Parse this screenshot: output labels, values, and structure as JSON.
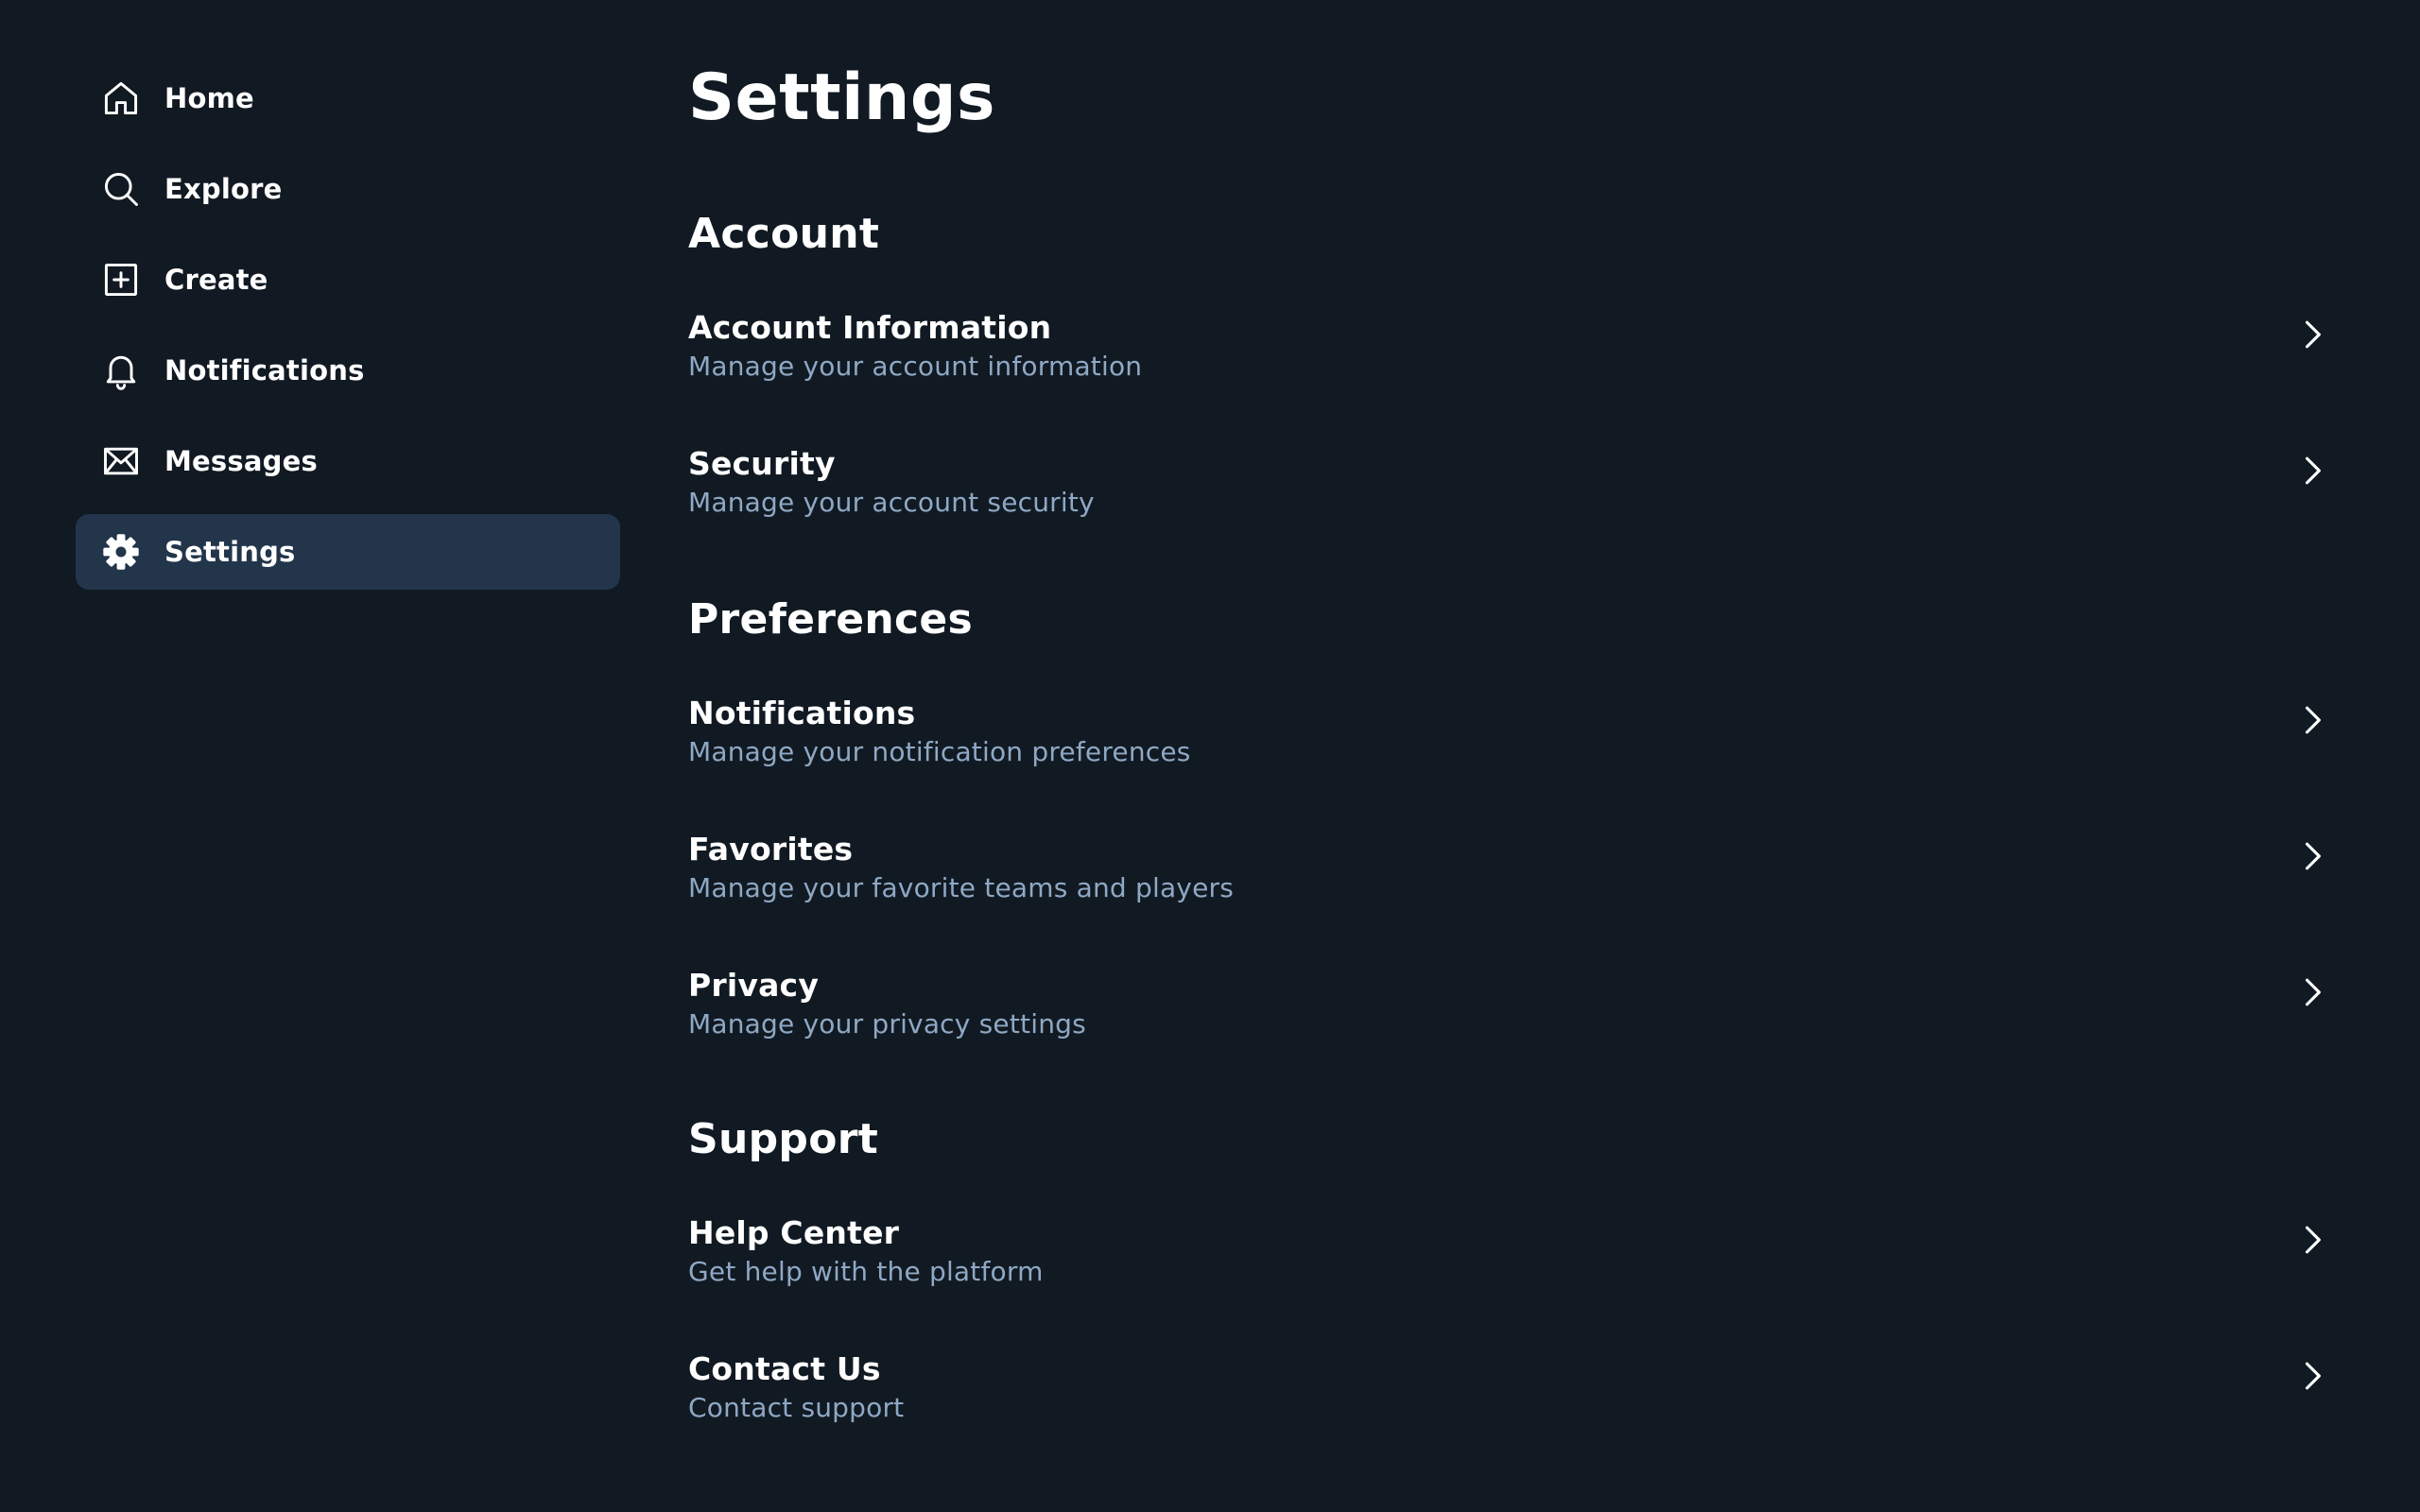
{
  "sidebar": {
    "items": [
      {
        "label": "Home",
        "icon": "home-icon"
      },
      {
        "label": "Explore",
        "icon": "search-icon"
      },
      {
        "label": "Create",
        "icon": "plus-square-icon"
      },
      {
        "label": "Notifications",
        "icon": "bell-icon"
      },
      {
        "label": "Messages",
        "icon": "mail-icon"
      },
      {
        "label": "Settings",
        "icon": "gear-icon",
        "active": true
      }
    ]
  },
  "main": {
    "title": "Settings",
    "sections": [
      {
        "title": "Account",
        "rows": [
          {
            "title": "Account Information",
            "subtitle": "Manage your account information"
          },
          {
            "title": "Security",
            "subtitle": "Manage your account security"
          }
        ]
      },
      {
        "title": "Preferences",
        "rows": [
          {
            "title": "Notifications",
            "subtitle": "Manage your notification preferences"
          },
          {
            "title": "Favorites",
            "subtitle": "Manage your favorite teams and players"
          },
          {
            "title": "Privacy",
            "subtitle": "Manage your privacy settings"
          }
        ]
      },
      {
        "title": "Support",
        "rows": [
          {
            "title": "Help Center",
            "subtitle": "Get help with the platform"
          },
          {
            "title": "Contact Us",
            "subtitle": "Contact support"
          }
        ]
      }
    ]
  },
  "colors": {
    "background": "#111a23",
    "active_nav": "#22354b",
    "subtitle": "#8fa8c4",
    "text": "#ffffff"
  }
}
